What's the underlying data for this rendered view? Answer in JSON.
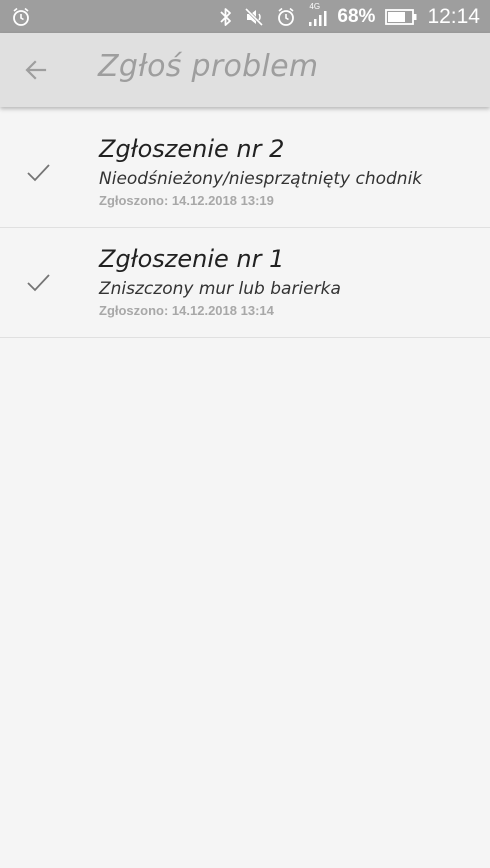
{
  "status_bar": {
    "battery": "68%",
    "time": "12:14",
    "network": "4G",
    "icons": [
      "alarm-icon",
      "bluetooth-icon",
      "mute-icon",
      "alarm-icon",
      "signal-icon",
      "battery-icon"
    ]
  },
  "toolbar": {
    "title": "Zgłoś problem",
    "back_icon": "arrow-left-icon"
  },
  "reports": [
    {
      "title": "Zgłoszenie nr 2",
      "category": "Nieodśnieżony/niesprzątnięty chodnik",
      "date": "Zgłoszono: 14.12.2018 13:19",
      "icon": "check-icon"
    },
    {
      "title": "Zgłoszenie nr 1",
      "category": "Zniszczony mur lub barierka",
      "date": "Zgłoszono: 14.12.2018 13:14",
      "icon": "check-icon"
    }
  ],
  "colors": {
    "status_bar": "#9e9e9e",
    "toolbar": "#e0e0e0",
    "background": "#f5f5f5",
    "title_text": "#9e9e9e",
    "check": "#757575"
  }
}
